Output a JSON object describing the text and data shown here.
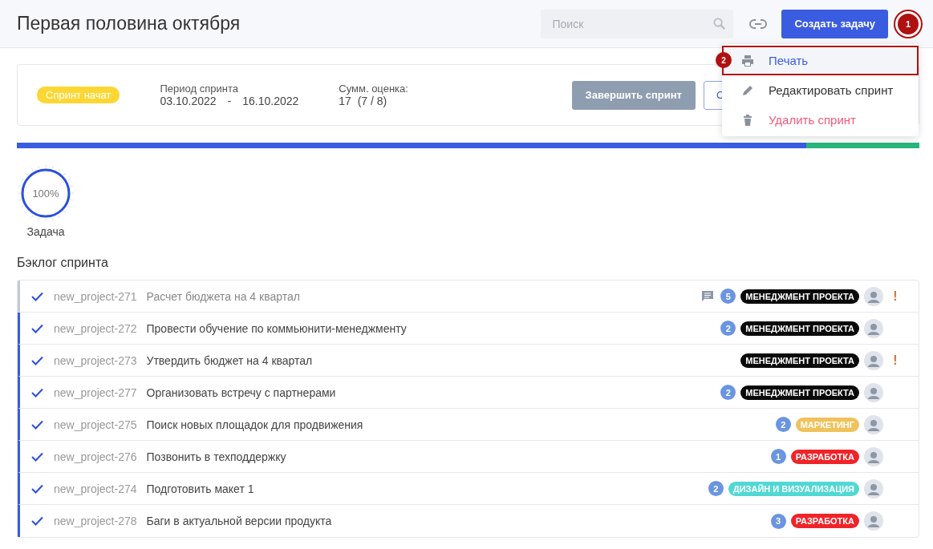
{
  "header": {
    "title": "Первая половина октября",
    "search": {
      "placeholder": "Поиск"
    },
    "create_button": "Создать задачу",
    "callout": "1"
  },
  "menu": {
    "items": [
      {
        "kind": "print",
        "label": "Печать",
        "selected": true,
        "callout": "2"
      },
      {
        "kind": "edit",
        "label": "Редактировать спринт",
        "selected": false
      },
      {
        "kind": "delete",
        "label": "Удалить спринт",
        "selected": false
      }
    ]
  },
  "sprint": {
    "status": "Спринт начат",
    "period_label": "Период спринта",
    "start": "03.10.2022",
    "dash": "-",
    "end": "16.10.2022",
    "estimate_label": "Сумм. оценка:",
    "estimate": "17  (7 / 8)",
    "finish_button": "Завершить спринт",
    "second_button": "С"
  },
  "progress": {
    "level": 0.875
  },
  "gauge": {
    "level": 1,
    "reading": "100%",
    "label": "Задача"
  },
  "backlog": {
    "title": "Бэклог спринта",
    "tasks": [
      {
        "key": "new_project-271",
        "title": "Расчет бюджета на 4 квартал",
        "done": true,
        "dimmed": true,
        "has_comments": true,
        "count": "5",
        "tag": "МЕНЕДЖМЕНТ ПРОЕКТА",
        "color": "#0a0a0a",
        "priority": "!"
      },
      {
        "key": "new_project-272",
        "title": "Провести обучение по коммьюнити-менеджменту",
        "done": true,
        "dimmed": false,
        "has_comments": false,
        "count": "2",
        "tag": "МЕНЕДЖМЕНТ ПРОЕКТА",
        "color": "#0a0a0a"
      },
      {
        "key": "new_project-273",
        "title": "Утвердить бюджет на 4 квартал",
        "done": true,
        "dimmed": false,
        "has_comments": false,
        "tag": "МЕНЕДЖМЕНТ ПРОЕКТА",
        "color": "#0a0a0a",
        "priority": "!"
      },
      {
        "key": "new_project-277",
        "title": "Организовать встречу с партнерами",
        "done": true,
        "dimmed": false,
        "has_comments": false,
        "count": "2",
        "tag": "МЕНЕДЖМЕНТ ПРОЕКТА",
        "color": "#0a0a0a"
      },
      {
        "key": "new_project-275",
        "title": "Поиск новых площадок для продвижения",
        "done": true,
        "dimmed": false,
        "has_comments": false,
        "count": "2",
        "tag": "МАРКЕТИНГ",
        "color": "#f0c25c"
      },
      {
        "key": "new_project-276",
        "title": "Позвонить в техподдержку",
        "done": true,
        "dimmed": false,
        "has_comments": false,
        "count": "1",
        "tag": "РАЗРАБОТКА",
        "color": "#f02329"
      },
      {
        "key": "new_project-274",
        "title": "Подготовить макет 1",
        "done": true,
        "dimmed": false,
        "has_comments": false,
        "count": "2",
        "tag": "ДИЗАЙН И ВИЗУАЛИЗАЦИЯ",
        "color": "#50d8d3"
      },
      {
        "key": "new_project-278",
        "title": "Баги в актуальной версии продукта",
        "done": true,
        "dimmed": false,
        "has_comments": false,
        "count": "3",
        "tag": "РАЗРАБОТКА",
        "color": "#f02329"
      }
    ]
  }
}
